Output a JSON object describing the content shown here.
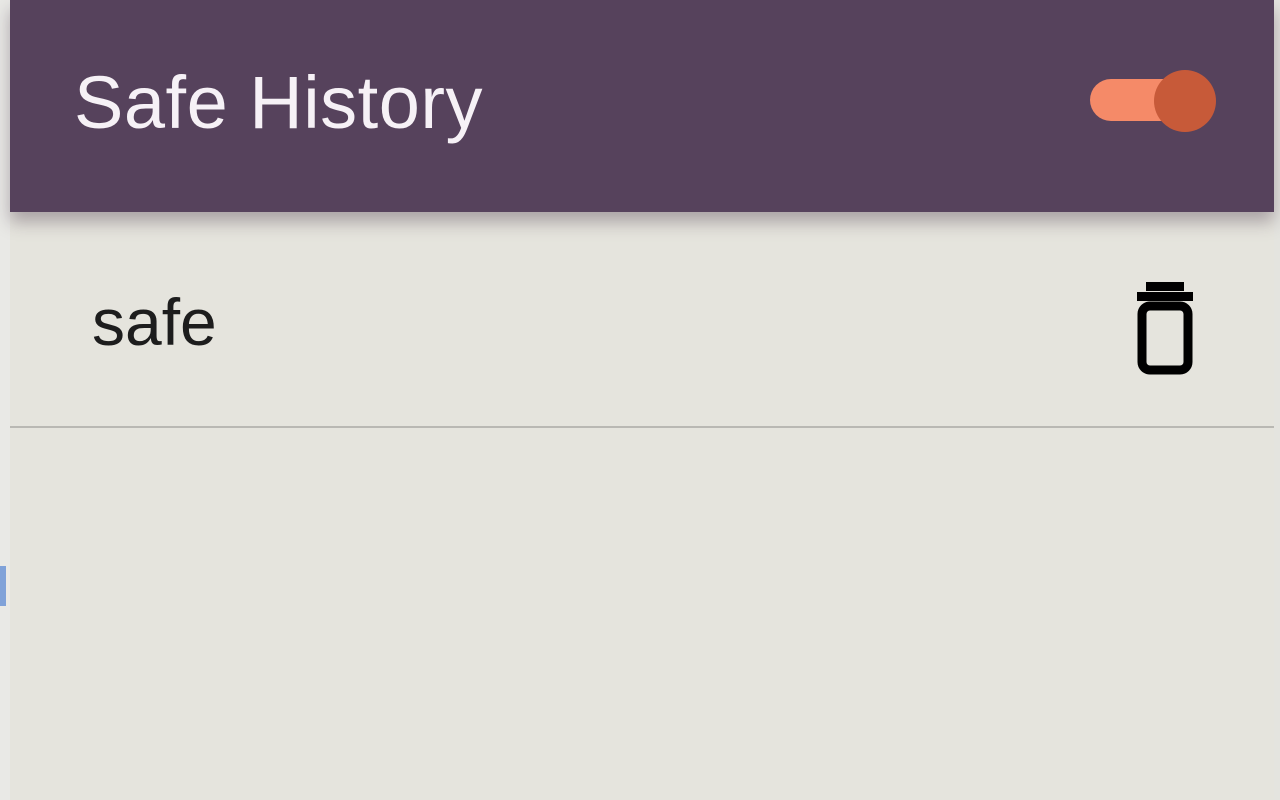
{
  "header": {
    "title": "Safe History",
    "toggle": {
      "enabled": true,
      "track_color": "#f58a68",
      "knob_color": "#c75a39"
    },
    "background_color": "#56425c"
  },
  "history": {
    "items": [
      {
        "label": "safe",
        "action_icon": "trash-icon"
      }
    ]
  },
  "colors": {
    "body_background": "#e5e4dd",
    "divider": "#b9b8b3"
  }
}
